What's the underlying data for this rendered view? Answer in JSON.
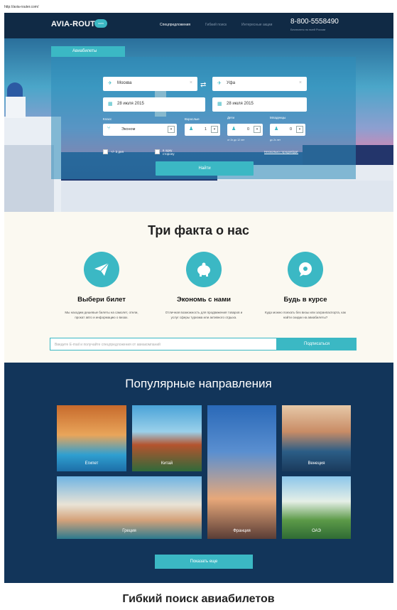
{
  "browser": {
    "url": "http://avia-router.com/"
  },
  "header": {
    "logo": "AVIA-ROUTER",
    "logo_badge": "com",
    "nav": [
      "Спецпредложения",
      "Гибкий поиск",
      "Интересные акции"
    ],
    "phone": "8-800-5558490",
    "phone_sub": "Бесплатно по всей России"
  },
  "search": {
    "tab": "Авиабилеты",
    "from": "Москва",
    "to": "Уфа",
    "date_from": "28 июля 2015",
    "date_to": "28 июля 2015",
    "class_label": "Класс",
    "class_value": "Эконом",
    "adults_label": "Взрослые",
    "adults_value": "1",
    "children_label": "Дети",
    "children_sub": "от 2х до 12 лет",
    "children_value": "0",
    "infants_label": "Младенцы",
    "infants_sub": "до 2х лет",
    "infants_value": "0",
    "checkbox1": "+/- 3 дня",
    "checkbox2": "в одну сторону",
    "complex_route": "Несколько городов/дат",
    "search_button": "Найти"
  },
  "facts": {
    "title": "Три факта о нас",
    "items": [
      {
        "icon": "paper-plane-icon",
        "title": "Выбери билет",
        "text": "Мы находим дешевые билеты на самолет, отели, прокат авто и информацию о визах."
      },
      {
        "icon": "piggy-bank-icon",
        "title": "Экономь с нами",
        "text": "Отличная возможность для продвижения товаров и услуг сферы туризма или активного отдыха."
      },
      {
        "icon": "chat-bubble-icon",
        "title": "Будь в курсе",
        "text": "Куда можно поехать без визы или загранпаспорта, как найти скидки на авиабилеты?"
      }
    ],
    "subscribe_placeholder": "Введите E-mail и получайте спецпредложения от авиакомпаний",
    "subscribe_button": "Подписаться"
  },
  "destinations": {
    "title": "Популярные направления",
    "tiles": [
      "Египет",
      "Китай",
      "",
      "Венеция",
      "Греция",
      "Франция",
      "ОАЭ"
    ],
    "show_more": "Показать еще"
  },
  "flex": {
    "title": "Гибкий поиск авиабилетов"
  }
}
